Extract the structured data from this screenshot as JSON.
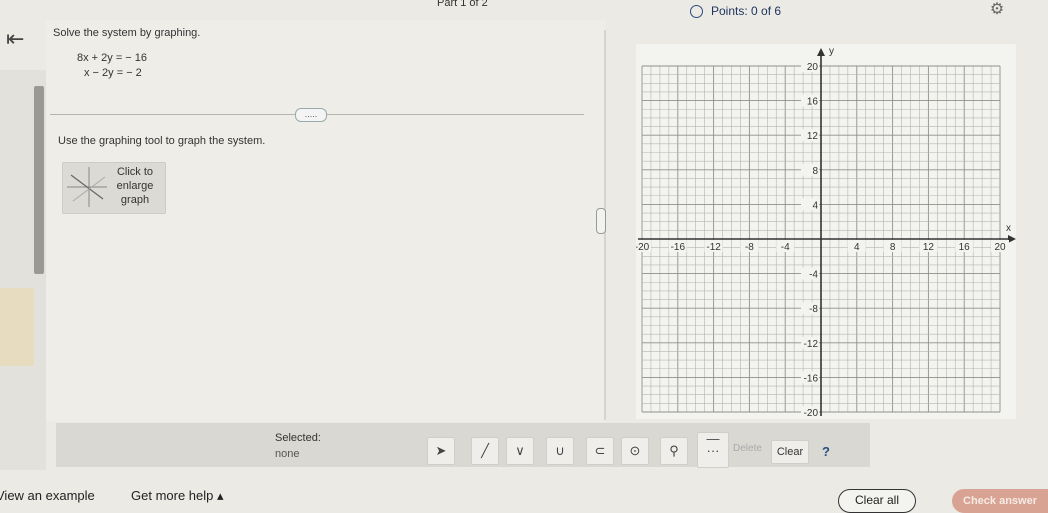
{
  "header": {
    "part": "Part 1 of 2",
    "points": "Points: 0 of 6"
  },
  "question": {
    "instruction": "Solve the system by graphing.",
    "equations": [
      "8x + 2y = − 16",
      "x − 2y = − 2"
    ],
    "tool_instruction": "Use the graphing tool to graph the system.",
    "enlarge_label_lines": [
      "Click to",
      "enlarge",
      "graph"
    ],
    "more_dots": "....."
  },
  "graph": {
    "xlabel": "x",
    "ylabel": "y",
    "x_range": [
      -20,
      20
    ],
    "y_range": [
      -20,
      20
    ],
    "grid_step": 1,
    "x_tick_labels": [
      "-20",
      "-16",
      "-12",
      "-8",
      "-4",
      "4",
      "8",
      "12",
      "16",
      "20"
    ],
    "y_tick_labels": [
      "20",
      "16",
      "12",
      "8",
      "4",
      "-4",
      "-8",
      "-12",
      "-16",
      "-20"
    ]
  },
  "toolbar": {
    "selected_label": "Selected:",
    "selected_value": "none",
    "tools": [
      "select-pointer",
      "line",
      "ray-down",
      "parabola",
      "arc",
      "circle",
      "fill",
      "dashed-line"
    ],
    "delete_label": "Delete",
    "clear_label": "Clear",
    "help_label": "?"
  },
  "footer": {
    "view_example": "View an example",
    "get_help": "Get more help ▴",
    "clear_all": "Clear all",
    "check_answer": "Check answer"
  },
  "colors": {
    "points_blue": "#1f3560",
    "help_blue": "#2a4c80",
    "check_answer_bg": "#d9a393"
  }
}
